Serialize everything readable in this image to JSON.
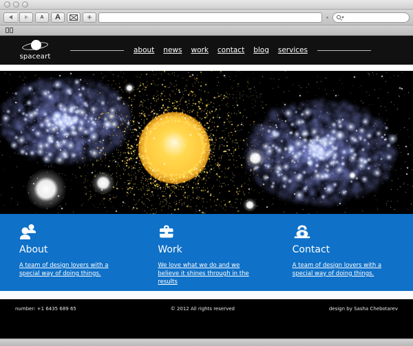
{
  "browser": {
    "window_controls": [
      "close",
      "minimize",
      "zoom"
    ],
    "toolbar": {
      "back_label": "back",
      "forward_label": "forward",
      "text_smaller_label": "A",
      "text_larger_label": "A",
      "reader_label": "reader",
      "add_label": "+",
      "url_value": "",
      "url_placeholder": "",
      "search_value": "",
      "search_placeholder": ""
    },
    "bookmarks": {
      "show_all_label": "bookmarks"
    }
  },
  "site": {
    "logo": {
      "text": "spaceart",
      "icon": "planet-with-ring-icon"
    },
    "nav": [
      {
        "label": "about"
      },
      {
        "label": "news"
      },
      {
        "label": "work"
      },
      {
        "label": "contact"
      },
      {
        "label": "blog"
      },
      {
        "label": "services"
      }
    ],
    "hero": {
      "alt": "deep space scene with blue nebulae, white star orbs and a bright yellow sun",
      "background_color": "#000000",
      "nebula_color": "#7b86d8",
      "sun_color": "#ffc83c",
      "star_color": "#ffffff"
    },
    "features": [
      {
        "icon": "users-icon",
        "title": "About",
        "text": "A team of design lovers with a special way of doing things."
      },
      {
        "icon": "briefcase-icon",
        "title": "Work",
        "text": "We love what we do and we believe it shines through in the results"
      },
      {
        "icon": "telephone-icon",
        "title": "Contact",
        "text": "A team of design lovers with a special way of doing things."
      }
    ],
    "footer": {
      "phone": "number: +1 6435 689 65",
      "copyright": "© 2012 All rights reserved",
      "credit": "design by Sasha Chebotarev"
    },
    "colors": {
      "accent_blue": "#0f71c8",
      "header_black": "#111111",
      "footer_black": "#000000"
    }
  }
}
